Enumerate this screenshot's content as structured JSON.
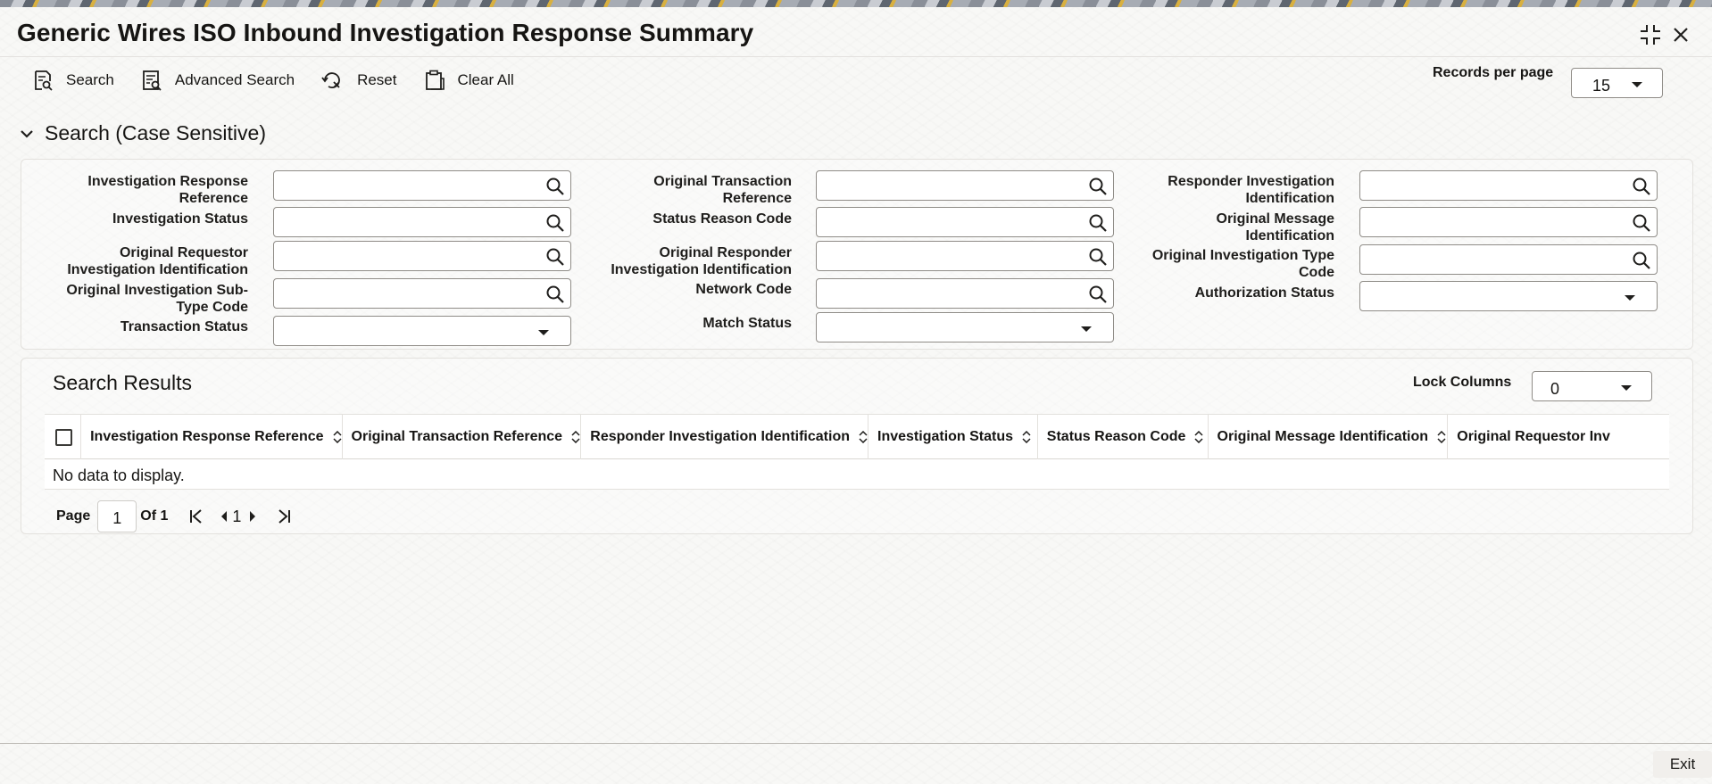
{
  "window": {
    "title": "Generic Wires ISO Inbound Investigation Response Summary"
  },
  "toolbar": {
    "search_label": "Search",
    "advanced_search_label": "Advanced Search",
    "reset_label": "Reset",
    "clear_all_label": "Clear All"
  },
  "records_per_page": {
    "label": "Records per page",
    "value": "15"
  },
  "search_section": {
    "title": "Search (Case Sensitive)",
    "fields": {
      "investigation_response_reference": {
        "label_1": "Investigation Response",
        "label_2": "Reference",
        "value": ""
      },
      "investigation_status": {
        "label": "Investigation Status",
        "value": ""
      },
      "original_requestor_investigation_identification": {
        "label_1": "Original Requestor",
        "label_2": "Investigation Identification",
        "value": ""
      },
      "original_investigation_sub_type_code": {
        "label_1": "Original Investigation Sub-",
        "label_2": "Type Code",
        "value": ""
      },
      "transaction_status": {
        "label": "Transaction Status",
        "value": ""
      },
      "original_transaction_reference": {
        "label_1": "Original Transaction",
        "label_2": "Reference",
        "value": ""
      },
      "status_reason_code": {
        "label": "Status Reason Code",
        "value": ""
      },
      "original_responder_investigation_identification": {
        "label_1": "Original Responder",
        "label_2": "Investigation Identification",
        "value": ""
      },
      "network_code": {
        "label": "Network Code",
        "value": ""
      },
      "match_status": {
        "label": "Match Status",
        "value": ""
      },
      "responder_investigation_identification": {
        "label_1": "Responder Investigation",
        "label_2": "Identification",
        "value": ""
      },
      "original_message_identification": {
        "label_1": "Original Message",
        "label_2": "Identification",
        "value": ""
      },
      "original_investigation_type_code": {
        "label_1": "Original Investigation Type",
        "label_2": "Code",
        "value": ""
      },
      "authorization_status": {
        "label": "Authorization Status",
        "value": ""
      }
    }
  },
  "results": {
    "title": "Search Results",
    "lock_columns": {
      "label": "Lock Columns",
      "value": "0"
    },
    "columns": [
      "Investigation Response Reference",
      "Original Transaction Reference",
      "Responder Investigation Identification",
      "Investigation Status",
      "Status Reason Code",
      "Original Message Identification",
      "Original Requestor Inv"
    ],
    "empty_message": "No data to display."
  },
  "pagination": {
    "page_label": "Page",
    "current_page": "1",
    "of_label": "Of 1",
    "nav_page": "1"
  },
  "footer": {
    "exit_label": "Exit"
  }
}
